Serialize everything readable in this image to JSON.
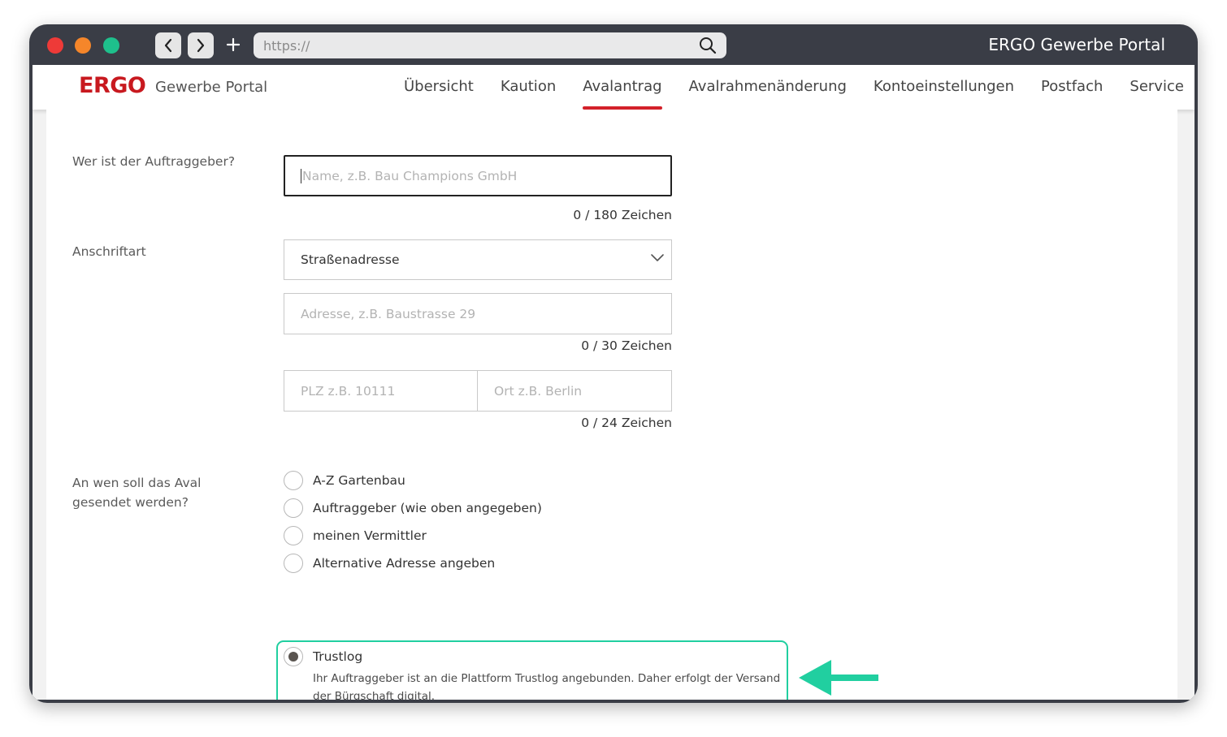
{
  "browser": {
    "url": "https://",
    "window_title": "ERGO Gewerbe Portal",
    "controls": [
      "close",
      "minimize",
      "maximize"
    ]
  },
  "header": {
    "logo": "ERGO",
    "portal_name": "Gewerbe Portal",
    "nav": [
      {
        "label": "Übersicht",
        "active": false
      },
      {
        "label": "Kaution",
        "active": false
      },
      {
        "label": "Avalantrag",
        "active": true
      },
      {
        "label": "Avalrahmenänderung",
        "active": false
      },
      {
        "label": "Kontoeinstellungen",
        "active": false
      },
      {
        "label": "Postfach",
        "active": false
      },
      {
        "label": "Service",
        "active": false
      }
    ]
  },
  "form": {
    "auftraggeber": {
      "label": "Wer ist der Auftraggeber?",
      "placeholder": "Name, z.B. Bau Champions GmbH",
      "value": "",
      "counter": "0 / 180 Zeichen"
    },
    "anschriftart": {
      "label": "Anschriftart",
      "selected": "Straßenadresse"
    },
    "adresse": {
      "placeholder": "Adresse, z.B. Baustrasse 29",
      "value": "",
      "counter": "0 / 30 Zeichen"
    },
    "plz": {
      "placeholder": "PLZ z.B. 10111",
      "value": ""
    },
    "ort": {
      "placeholder": "Ort z.B. Berlin",
      "value": ""
    },
    "plz_ort_counter": "0 / 24 Zeichen",
    "empfaenger": {
      "label": "An wen soll das Aval gesendet werden?",
      "options": [
        {
          "label": "A-Z Gartenbau",
          "selected": false
        },
        {
          "label": "Auftraggeber (wie oben angegeben)",
          "selected": false
        },
        {
          "label": "meinen Vermittler",
          "selected": false
        },
        {
          "label": "Alternative Adresse angeben",
          "selected": false
        },
        {
          "label": "Trustlog",
          "selected": true
        }
      ],
      "trustlog_description": "Ihr Auftraggeber ist an die Plattform Trustlog angebunden. Daher erfolgt der Versand der Bürgschaft digital."
    }
  },
  "colors": {
    "brand_red": "#c8191f",
    "active_underline": "#d3212a",
    "highlight": "#21cfa0",
    "window_chrome": "#3a3d46"
  }
}
